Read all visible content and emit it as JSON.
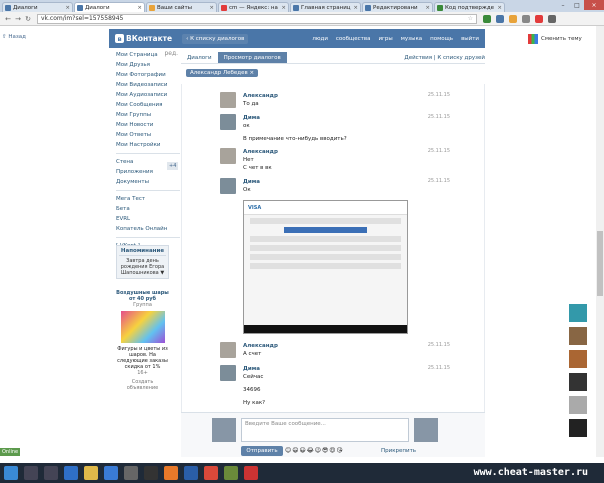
{
  "browser": {
    "tabs": [
      {
        "label": "Диалоги",
        "active": false
      },
      {
        "label": "Диалоги",
        "active": true
      },
      {
        "label": "Ваши сайты",
        "active": false
      },
      {
        "label": "cm — Яндекс: на",
        "active": false
      },
      {
        "label": "Главная страниц",
        "active": false
      },
      {
        "label": "Редактировани",
        "active": false
      },
      {
        "label": "Код подтвержде",
        "active": false
      }
    ],
    "url": "vk.com/im?sel=157558945"
  },
  "left": {
    "back_label": "Назад",
    "edit_label": "ред.",
    "badge": "+4",
    "nav": [
      "Мои Страница",
      "Мои Друзья",
      "Мои Фотографии",
      "Мои Видеозаписи",
      "Мои Аудиозаписи",
      "Мои Сообщения",
      "Мои Группы",
      "Мои Новости",
      "Мои Ответы",
      "Мои Настройки"
    ],
    "nav2": [
      "Стена",
      "Приложения",
      "Документы"
    ],
    "nav3": [
      "Мега Тест",
      "Бета",
      "EVRL",
      "Копатель Онлайн"
    ],
    "vkopt": "[ VKopt ]",
    "reminder": {
      "title": "Напоминание",
      "text": "Завтра день рождения Егора Шапошникова ▼"
    },
    "ad": {
      "title": "Воздушные шары от 40 руб",
      "sub": "Группа",
      "text": "Фигуры и цветы из шаров. На следующие заказы скидка от 1%",
      "age": "16+",
      "create": "Создать объявление"
    }
  },
  "header": {
    "logo_text": "ВКонтакте",
    "back_to_dialogs": "К списку диалогов",
    "nav": [
      "люди",
      "сообщества",
      "игры",
      "музыка",
      "помощь",
      "выйти"
    ]
  },
  "subtabs": {
    "dialogs": "Диалоги",
    "view": "Просмотр диалогов",
    "actions": "Действия",
    "friends": "К списку друзей"
  },
  "chip": "Александр Лебедев ×",
  "messages": [
    {
      "name": "Александр",
      "date": "25.11.15",
      "lines": [
        "То да"
      ]
    },
    {
      "name": "Дима",
      "date": "25.11.15",
      "lines": [
        "ок",
        "",
        "В примечание что-нибудь вводить?"
      ]
    },
    {
      "name": "Александр",
      "date": "25.11.15",
      "lines": [
        "Нет",
        "С чет в вк"
      ]
    },
    {
      "name": "Дима",
      "date": "25.11.15",
      "lines": [
        "Ок"
      ]
    },
    {
      "name": "Александр",
      "date": "25.11.15",
      "lines": [
        "А счет"
      ]
    },
    {
      "name": "Дима",
      "date": "25.11.15",
      "lines": [
        "Сейчас",
        "",
        "34696",
        "",
        "Ну как?"
      ]
    }
  ],
  "screenshot_title": "VISA",
  "composer": {
    "placeholder": "Введите Ваше сообщение...",
    "send": "Отправить",
    "attach": "Прикрепить",
    "emojis": "😊😄😃😂😉😎😍😘"
  },
  "right": {
    "change_theme": "Сменить тему"
  },
  "status": {
    "online": "Online"
  },
  "watermark": "www.cheat-master.ru"
}
